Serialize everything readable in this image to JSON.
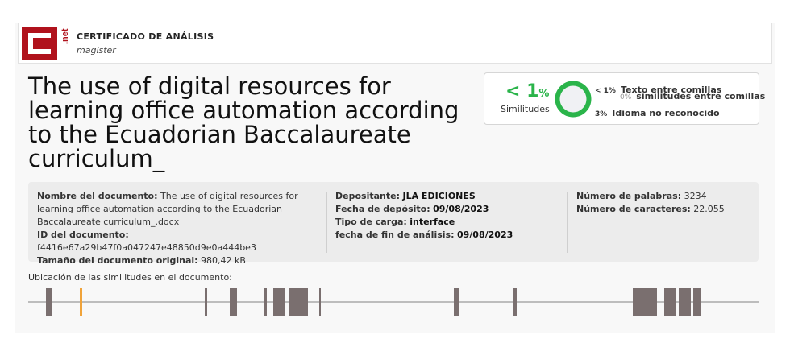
{
  "header": {
    "logo_text": ".net",
    "title": "CERTIFICADO DE ANÁLISIS",
    "subtitle": "magister"
  },
  "document_title": "The use of digital resources for learning office automation according to the Ecuadorian Baccalaureate curriculum_",
  "similarity": {
    "percent_main": "< 1",
    "percent_sign": "%",
    "label": "Similitudes",
    "rows": [
      {
        "percent": "< 1%",
        "label": "Texto entre comillas"
      },
      {
        "percent": "0%",
        "label": "similitudes entre comillas"
      },
      {
        "percent": "3%",
        "label": "Idioma no reconocido"
      }
    ],
    "colors": {
      "accent": "#2ab44a",
      "gray": "#999999"
    }
  },
  "details": {
    "col1": {
      "name_label": "Nombre del documento:",
      "name_value": "The use of digital resources for learning office automation according to the Ecuadorian Baccalaureate curriculum_.docx",
      "id_label": "ID del documento:",
      "id_value": "f4416e67a29b47f0a047247e48850d9e0a444be3",
      "size_label": "Tamaño del documento original:",
      "size_value": "980,42 kB"
    },
    "col2": {
      "depositor_label": "Depositante:",
      "depositor_value": "JLA EDICIONES",
      "deposit_date_label": "Fecha de depósito:",
      "deposit_date_value": "09/08/2023",
      "load_type_label": "Tipo de carga:",
      "load_type_value": "interface",
      "end_date_label": "fecha de fin de análisis:",
      "end_date_value": "09/08/2023"
    },
    "col3": {
      "words_label": "Número de palabras:",
      "words_value": "3234",
      "chars_label": "Número de caracteres:",
      "chars_value": "22.055"
    }
  },
  "location": {
    "label": "Ubicación de las similitudes en el documento:",
    "colors": {
      "match": "#7a6f6f",
      "quote": "#f0a33a"
    }
  }
}
